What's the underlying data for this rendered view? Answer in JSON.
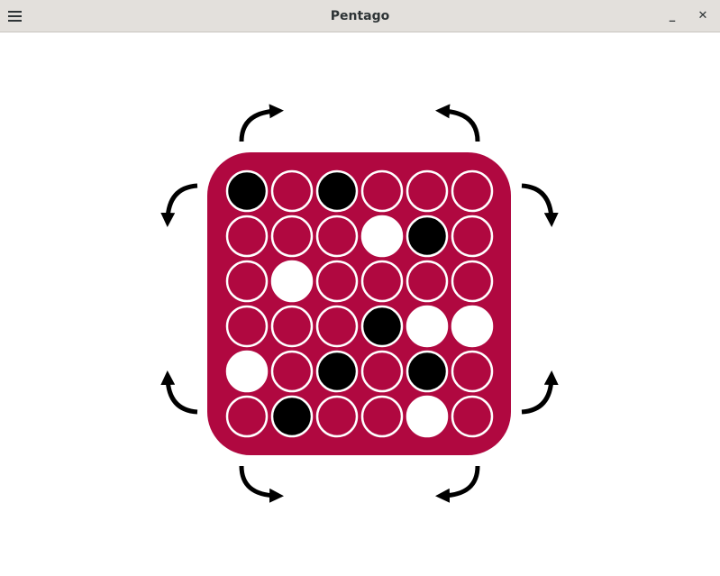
{
  "window": {
    "title": "Pentago",
    "minimize_glyph": "_",
    "close_glyph": "✕"
  },
  "colors": {
    "board": "#b00840",
    "black": "#000000",
    "white": "#ffffff",
    "ring": "#ffffff"
  },
  "board": {
    "rows": [
      [
        "black",
        "empty",
        "black",
        "empty",
        "empty",
        "empty"
      ],
      [
        "empty",
        "empty",
        "empty",
        "white",
        "black",
        "empty"
      ],
      [
        "empty",
        "white",
        "empty",
        "empty",
        "empty",
        "empty"
      ],
      [
        "empty",
        "empty",
        "empty",
        "black",
        "white",
        "white"
      ],
      [
        "white",
        "empty",
        "black",
        "empty",
        "black",
        "empty"
      ],
      [
        "empty",
        "black",
        "empty",
        "empty",
        "white",
        "empty"
      ]
    ]
  },
  "rotation_arrows": [
    {
      "name": "rotate-top-left-clockwise-icon",
      "quadrant": "top-left",
      "direction": "clockwise"
    },
    {
      "name": "rotate-top-left-counterclockwise-icon",
      "quadrant": "top-left",
      "direction": "counterclockwise"
    },
    {
      "name": "rotate-top-right-counterclockwise-icon",
      "quadrant": "top-right",
      "direction": "counterclockwise"
    },
    {
      "name": "rotate-top-right-clockwise-icon",
      "quadrant": "top-right",
      "direction": "clockwise"
    },
    {
      "name": "rotate-bottom-left-clockwise-icon",
      "quadrant": "bottom-left",
      "direction": "clockwise"
    },
    {
      "name": "rotate-bottom-left-counterclockwise-icon",
      "quadrant": "bottom-left",
      "direction": "counterclockwise"
    },
    {
      "name": "rotate-bottom-right-counterclockwise-icon",
      "quadrant": "bottom-right",
      "direction": "counterclockwise"
    },
    {
      "name": "rotate-bottom-right-clockwise-icon",
      "quadrant": "bottom-right",
      "direction": "clockwise"
    }
  ]
}
